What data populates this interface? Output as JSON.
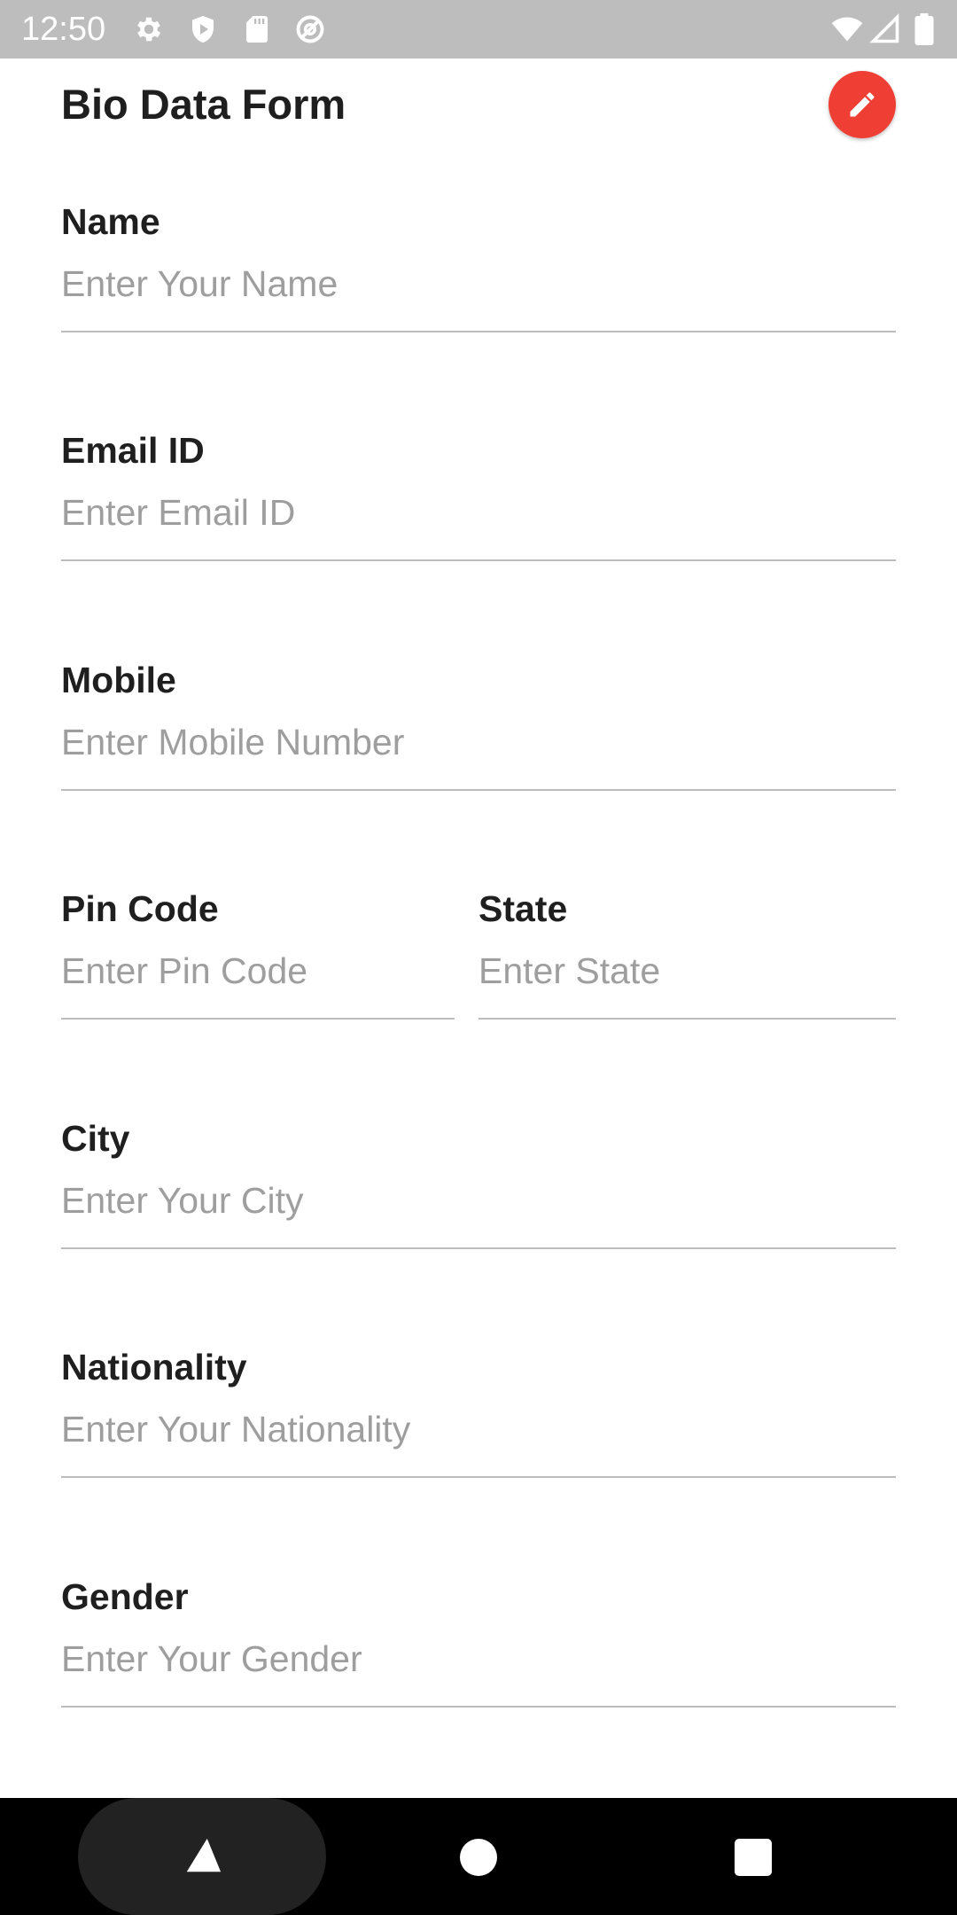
{
  "status_bar": {
    "time": "12:50",
    "left_icons": [
      "gear-icon",
      "shield-play-icon",
      "sd-card-icon",
      "at-sign-icon"
    ],
    "right_icons": [
      "wifi-icon",
      "signal-icon",
      "battery-icon"
    ]
  },
  "header": {
    "title": "Bio Data Form",
    "edit_icon": "pencil-icon",
    "edit_button_color": "#ef3f35"
  },
  "form": {
    "name": {
      "label": "Name",
      "placeholder": "Enter Your Name",
      "value": ""
    },
    "email": {
      "label": "Email ID",
      "placeholder": "Enter Email ID",
      "value": ""
    },
    "mobile": {
      "label": "Mobile",
      "placeholder": "Enter Mobile Number",
      "value": ""
    },
    "pin_code": {
      "label": "Pin Code",
      "placeholder": "Enter Pin Code",
      "value": ""
    },
    "state": {
      "label": "State",
      "placeholder": "Enter State",
      "value": ""
    },
    "city": {
      "label": "City",
      "placeholder": "Enter Your City",
      "value": ""
    },
    "nationality": {
      "label": "Nationality",
      "placeholder": "Enter Your Nationality",
      "value": ""
    },
    "gender": {
      "label": "Gender",
      "placeholder": "Enter Your Gender",
      "value": ""
    }
  },
  "nav_bar": {
    "back_icon": "triangle-back-icon",
    "home_icon": "circle-home-icon",
    "recents_icon": "square-recents-icon"
  }
}
